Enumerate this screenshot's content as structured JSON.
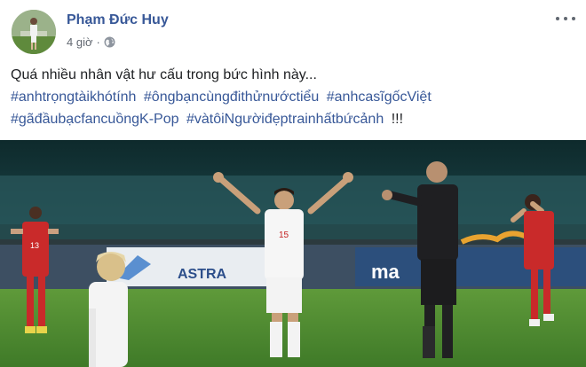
{
  "post": {
    "author_name": "Phạm Đức Huy",
    "timestamp": "4 giờ",
    "separator": "·",
    "privacy_icon": "globe-icon",
    "more_icon": "more-options-icon",
    "text_line1": "Quá nhiều nhân vật hư cấu trong bức hình này...",
    "hashtags_line2": [
      "#anhtrọngtàikhótính",
      "#ôngbạncùngđithửnướctiểu",
      "#anhcasĩgốcViệt"
    ],
    "hashtags_line3": [
      "#gãđầubạcfancuồngK-Pop",
      "#vàtôiNgườiđẹptrainhấtbứcảnh"
    ],
    "line3_suffix": "!!!"
  },
  "photo": {
    "banner_astra": "ASTRA",
    "banner_partial": "ma",
    "player_number": "15",
    "opponent_number": "13"
  },
  "colors": {
    "author_link": "#385898",
    "hashtag": "#385898",
    "meta_text": "#616770",
    "pitch_green": "#4f8a32"
  }
}
